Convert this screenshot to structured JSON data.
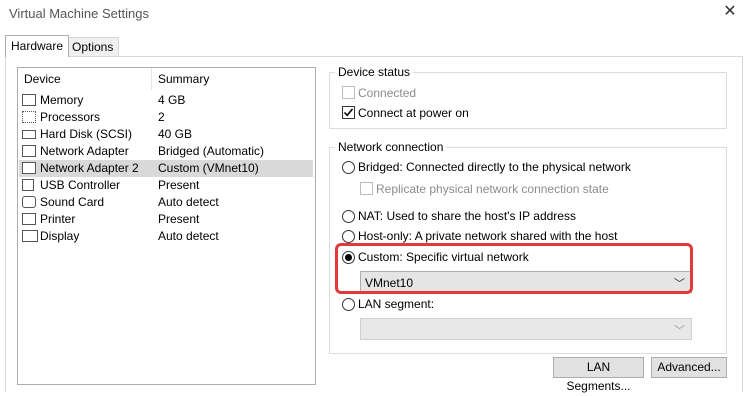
{
  "window": {
    "title": "Virtual Machine Settings",
    "close_glyph": "✕"
  },
  "tabs": [
    {
      "label": "Hardware",
      "active": true
    },
    {
      "label": "Options",
      "active": false
    }
  ],
  "device_list": {
    "headers": {
      "device": "Device",
      "summary": "Summary"
    },
    "rows": [
      {
        "name": "Memory",
        "summary": "4 GB",
        "icon": "memory-icon",
        "selected": false
      },
      {
        "name": "Processors",
        "summary": "2",
        "icon": "processor-icon",
        "selected": false
      },
      {
        "name": "Hard Disk (SCSI)",
        "summary": "40 GB",
        "icon": "hard-disk-icon",
        "selected": false
      },
      {
        "name": "Network Adapter",
        "summary": "Bridged (Automatic)",
        "icon": "network-adapter-icon",
        "selected": false
      },
      {
        "name": "Network Adapter 2",
        "summary": "Custom (VMnet10)",
        "icon": "network-adapter-icon",
        "selected": true
      },
      {
        "name": "USB Controller",
        "summary": "Present",
        "icon": "usb-icon",
        "selected": false
      },
      {
        "name": "Sound Card",
        "summary": "Auto detect",
        "icon": "sound-card-icon",
        "selected": false
      },
      {
        "name": "Printer",
        "summary": "Present",
        "icon": "printer-icon",
        "selected": false
      },
      {
        "name": "Display",
        "summary": "Auto detect",
        "icon": "display-icon",
        "selected": false
      }
    ]
  },
  "device_status": {
    "legend": "Device status",
    "connected": {
      "label": "Connected",
      "checked": false,
      "enabled": false
    },
    "connect_at_power_on": {
      "label": "Connect at power on",
      "checked": true,
      "enabled": true
    }
  },
  "network_connection": {
    "legend": "Network connection",
    "bridged": {
      "label": "Bridged: Connected directly to the physical network",
      "selected": false
    },
    "replicate": {
      "label": "Replicate physical network connection state",
      "checked": false,
      "enabled": false
    },
    "nat": {
      "label": "NAT: Used to share the host's IP address",
      "selected": false
    },
    "host_only": {
      "label": "Host-only: A private network shared with the host",
      "selected": false
    },
    "custom": {
      "label": "Custom: Specific virtual network",
      "selected": true,
      "value": "VMnet10"
    },
    "lan_segment": {
      "label": "LAN segment:",
      "selected": false,
      "value": ""
    }
  },
  "buttons": {
    "lan_segments": "LAN Segments...",
    "advanced": "Advanced..."
  },
  "colors": {
    "highlight": "#e03a3a",
    "selected_row": "#d9d9d9"
  }
}
